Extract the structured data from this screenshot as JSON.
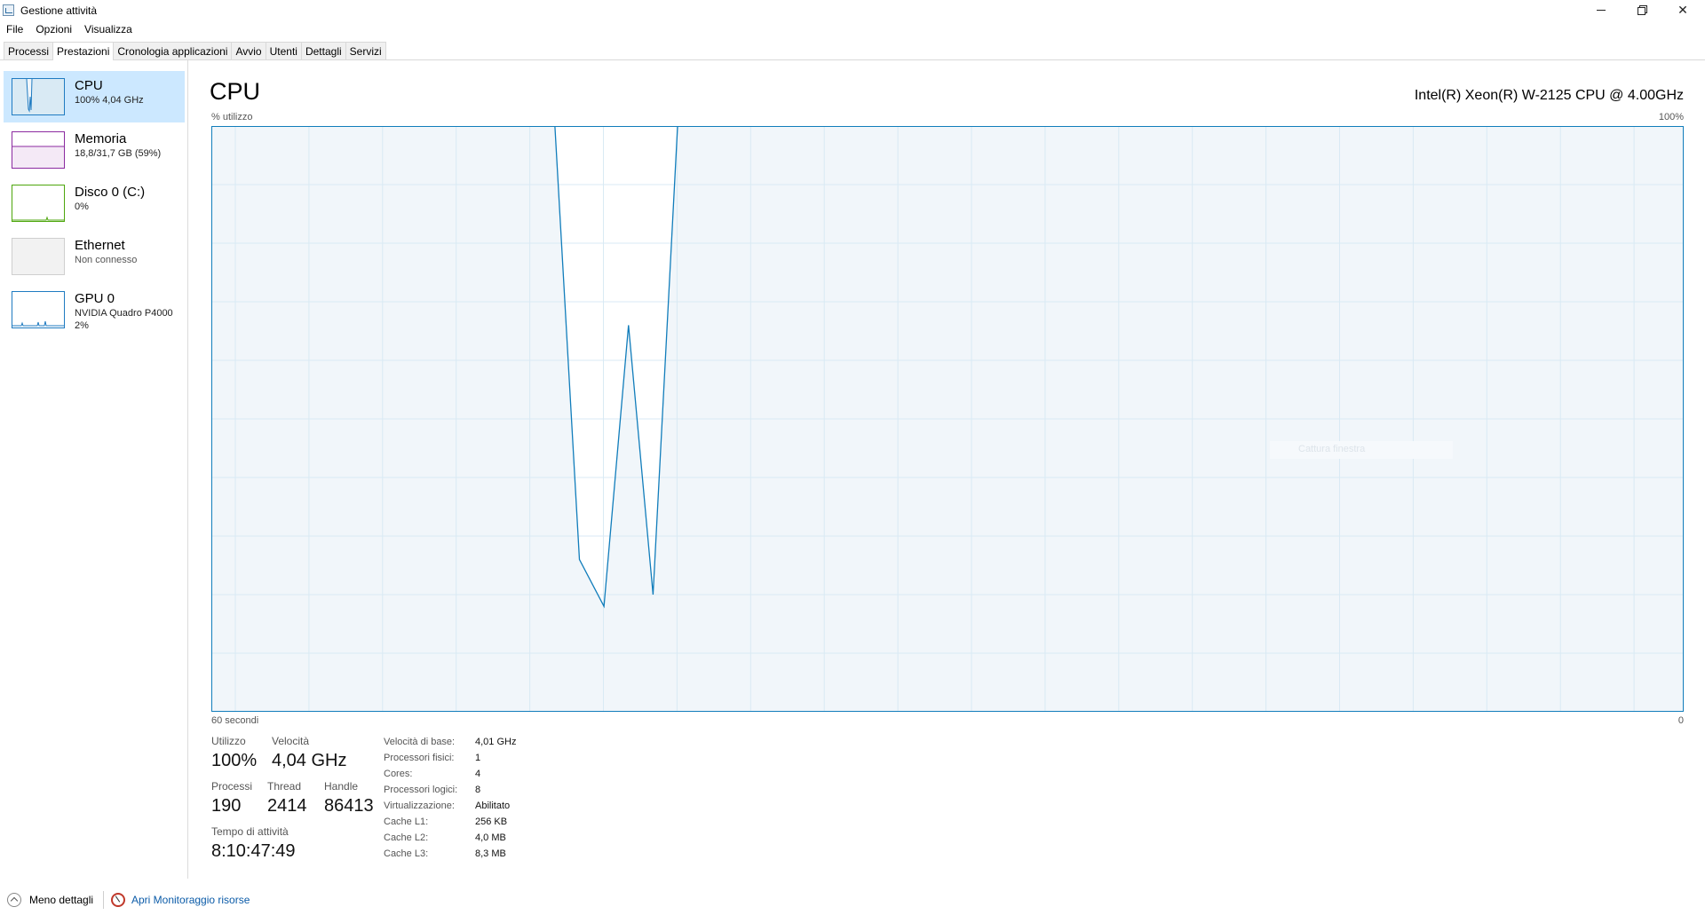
{
  "window": {
    "title": "Gestione attività"
  },
  "menu": [
    "File",
    "Opzioni",
    "Visualizza"
  ],
  "tabs": [
    "Processi",
    "Prestazioni",
    "Cronologia applicazioni",
    "Avvio",
    "Utenti",
    "Dettagli",
    "Servizi"
  ],
  "active_tab": "Prestazioni",
  "sidebar": {
    "items": [
      {
        "title": "CPU",
        "sub1": "100%  4,04 GHz",
        "sub2": "",
        "color": "#1f7bc1",
        "selected": true
      },
      {
        "title": "Memoria",
        "sub1": "18,8/31,7 GB (59%)",
        "sub2": "",
        "color": "#8b2aa0",
        "selected": false
      },
      {
        "title": "Disco 0 (C:)",
        "sub1": "0%",
        "sub2": "",
        "color": "#4da60c",
        "selected": false
      },
      {
        "title": "Ethernet",
        "sub1": "Non connesso",
        "sub2": "",
        "color": "#a05a0a",
        "selected": false
      },
      {
        "title": "GPU 0",
        "sub1": "NVIDIA Quadro P4000",
        "sub2": "2%",
        "color": "#1f7bc1",
        "selected": false
      }
    ]
  },
  "main": {
    "title": "CPU",
    "model": "Intel(R) Xeon(R) W-2125 CPU @ 4.00GHz",
    "util_label": "% utilizzo",
    "max_label": "100%",
    "seconds_label": "60 secondi",
    "zero_label": "0",
    "ghost_text": "Cattura finestra",
    "line_color": "#117dbb",
    "fill_color": "#f1f6fa",
    "grid_color": "#d9eaf4"
  },
  "chart_data": {
    "type": "area",
    "x": [
      60,
      46,
      45,
      44,
      43,
      42,
      41,
      0
    ],
    "y": [
      100,
      100,
      26,
      18,
      66,
      20,
      100,
      100
    ],
    "ylim": [
      0,
      100
    ],
    "xlim": [
      60,
      0
    ],
    "grid": true
  },
  "stats": {
    "util_label": "Utilizzo",
    "util_value": "100%",
    "speed_label": "Velocità",
    "speed_value": "4,04 GHz",
    "proc_label": "Processi",
    "proc_value": "190",
    "thread_label": "Thread",
    "thread_value": "2414",
    "handle_label": "Handle",
    "handle_value": "86413",
    "uptime_label": "Tempo di attività",
    "uptime_value": "8:10:47:49"
  },
  "details": [
    {
      "k": "Velocità di base:",
      "v": "4,01 GHz"
    },
    {
      "k": "Processori fisici:",
      "v": "1"
    },
    {
      "k": "Cores:",
      "v": "4"
    },
    {
      "k": "Processori logici:",
      "v": "8"
    },
    {
      "k": "Virtualizzazione:",
      "v": "Abilitato"
    },
    {
      "k": "Cache L1:",
      "v": "256 KB"
    },
    {
      "k": "Cache L2:",
      "v": "4,0 MB"
    },
    {
      "k": "Cache L3:",
      "v": "8,3 MB"
    }
  ],
  "footer": {
    "fewer_details": "Meno dettagli",
    "resource_monitor": "Apri Monitoraggio risorse"
  }
}
